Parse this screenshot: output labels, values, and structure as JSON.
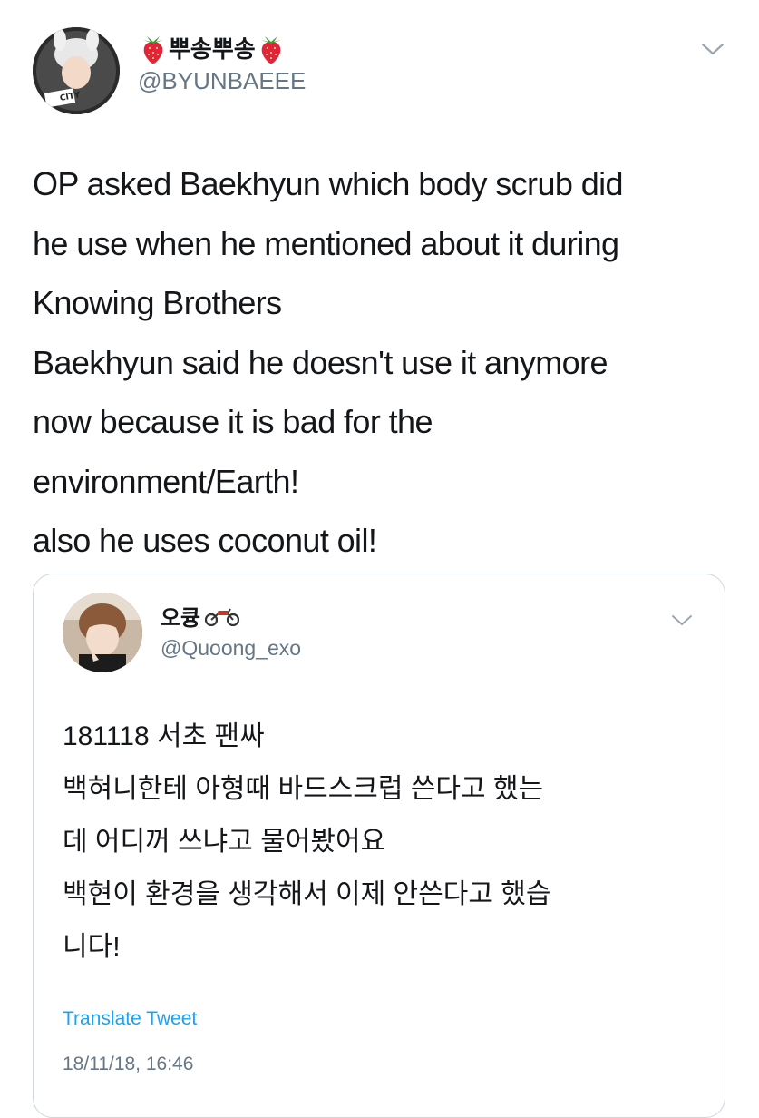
{
  "tweet": {
    "display_name": "뿌송뿌송",
    "handle": "@BYUNBAEEE",
    "avatar_badge": "CITY LIGHT",
    "name_emoji": "strawberry-icon",
    "text_lines": [
      "OP asked Baekhyun which body scrub did",
      "he use when he mentioned about it during",
      "Knowing Brothers",
      "Baekhyun said he doesn't use it anymore",
      "now because it is bad for the",
      "environment/Earth!",
      "also he uses coconut oil!"
    ]
  },
  "quoted_tweet": {
    "display_name": "오큥",
    "name_emoji": "motorcycle-icon",
    "handle": "@Quoong_exo",
    "text_lines": [
      "181118 서초 팬싸",
      "백혀니한테 아형때 바드스크럽 쓴다고 했는",
      "데 어디꺼 쓰냐고 물어봤어요",
      "백현이 환경을 생각해서 이제 안쓴다고 했습",
      "니다!"
    ],
    "translate_label": "Translate Tweet",
    "timestamp": "18/11/18, 16:46"
  },
  "colors": {
    "text": "#14171a",
    "secondary": "#657786",
    "link": "#1da1f2",
    "border": "#ccd6dd"
  }
}
